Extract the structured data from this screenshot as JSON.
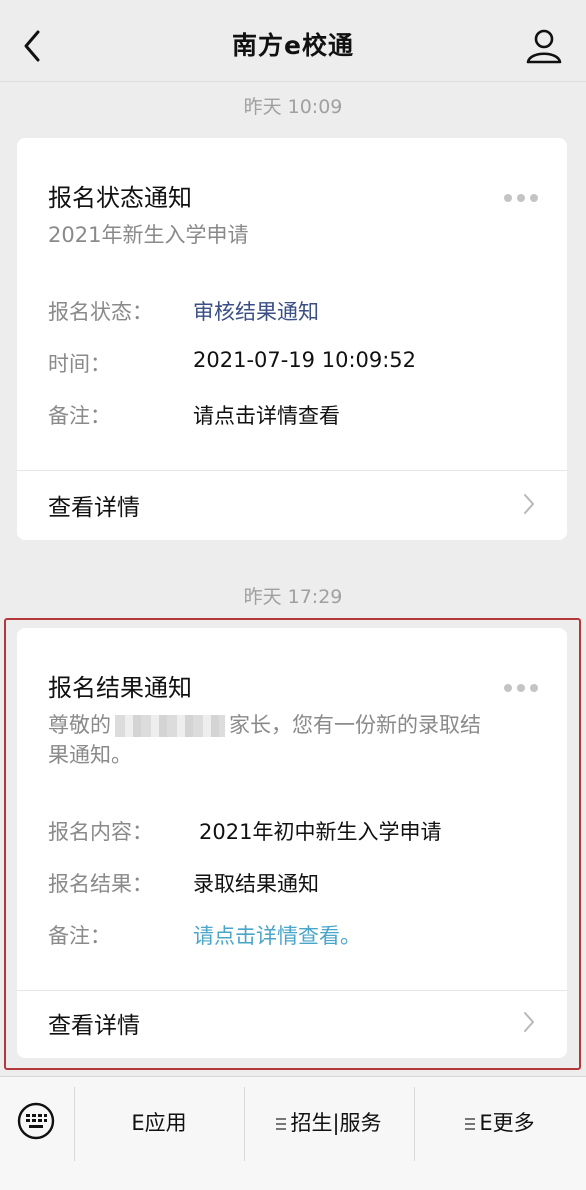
{
  "header": {
    "title": "南方e校通"
  },
  "messages": [
    {
      "timestamp": "昨天 10:09",
      "title": "报名状态通知",
      "subtitle": "2021年新生入学申请",
      "fields": [
        {
          "label": "报名状态：",
          "value": "审核结果通知"
        },
        {
          "label": "时间：",
          "value": "2021-07-19 10:09:52"
        },
        {
          "label": "备注：",
          "value": "请点击详情查看"
        }
      ],
      "action": "查看详情"
    },
    {
      "timestamp": "昨天 17:29",
      "title": "报名结果通知",
      "subtitle_prefix": "尊敬的",
      "subtitle_suffix": "家长，您有一份新的录取结",
      "subtitle_line2": "果通知。",
      "fields": [
        {
          "label": "报名内容：",
          "value": "2021年初中新生入学申请"
        },
        {
          "label": "报名结果：",
          "value": "录取结果通知"
        },
        {
          "label": "备注：",
          "value": "请点击详情查看。"
        }
      ],
      "action": "查看详情"
    }
  ],
  "bottom_menu": {
    "items": [
      {
        "label": "E应用"
      },
      {
        "label": "招生|服务"
      },
      {
        "label": "E更多"
      }
    ]
  },
  "colors": {
    "link_dark": "#3b4f86",
    "link_light": "#4aa6c8",
    "highlight_frame": "#b4373a"
  },
  "icons": {
    "back": "chevron-left-icon",
    "profile": "user-icon",
    "more": "more-dots-icon",
    "chevron": "chevron-right-icon",
    "keyboard": "keyboard-icon"
  }
}
